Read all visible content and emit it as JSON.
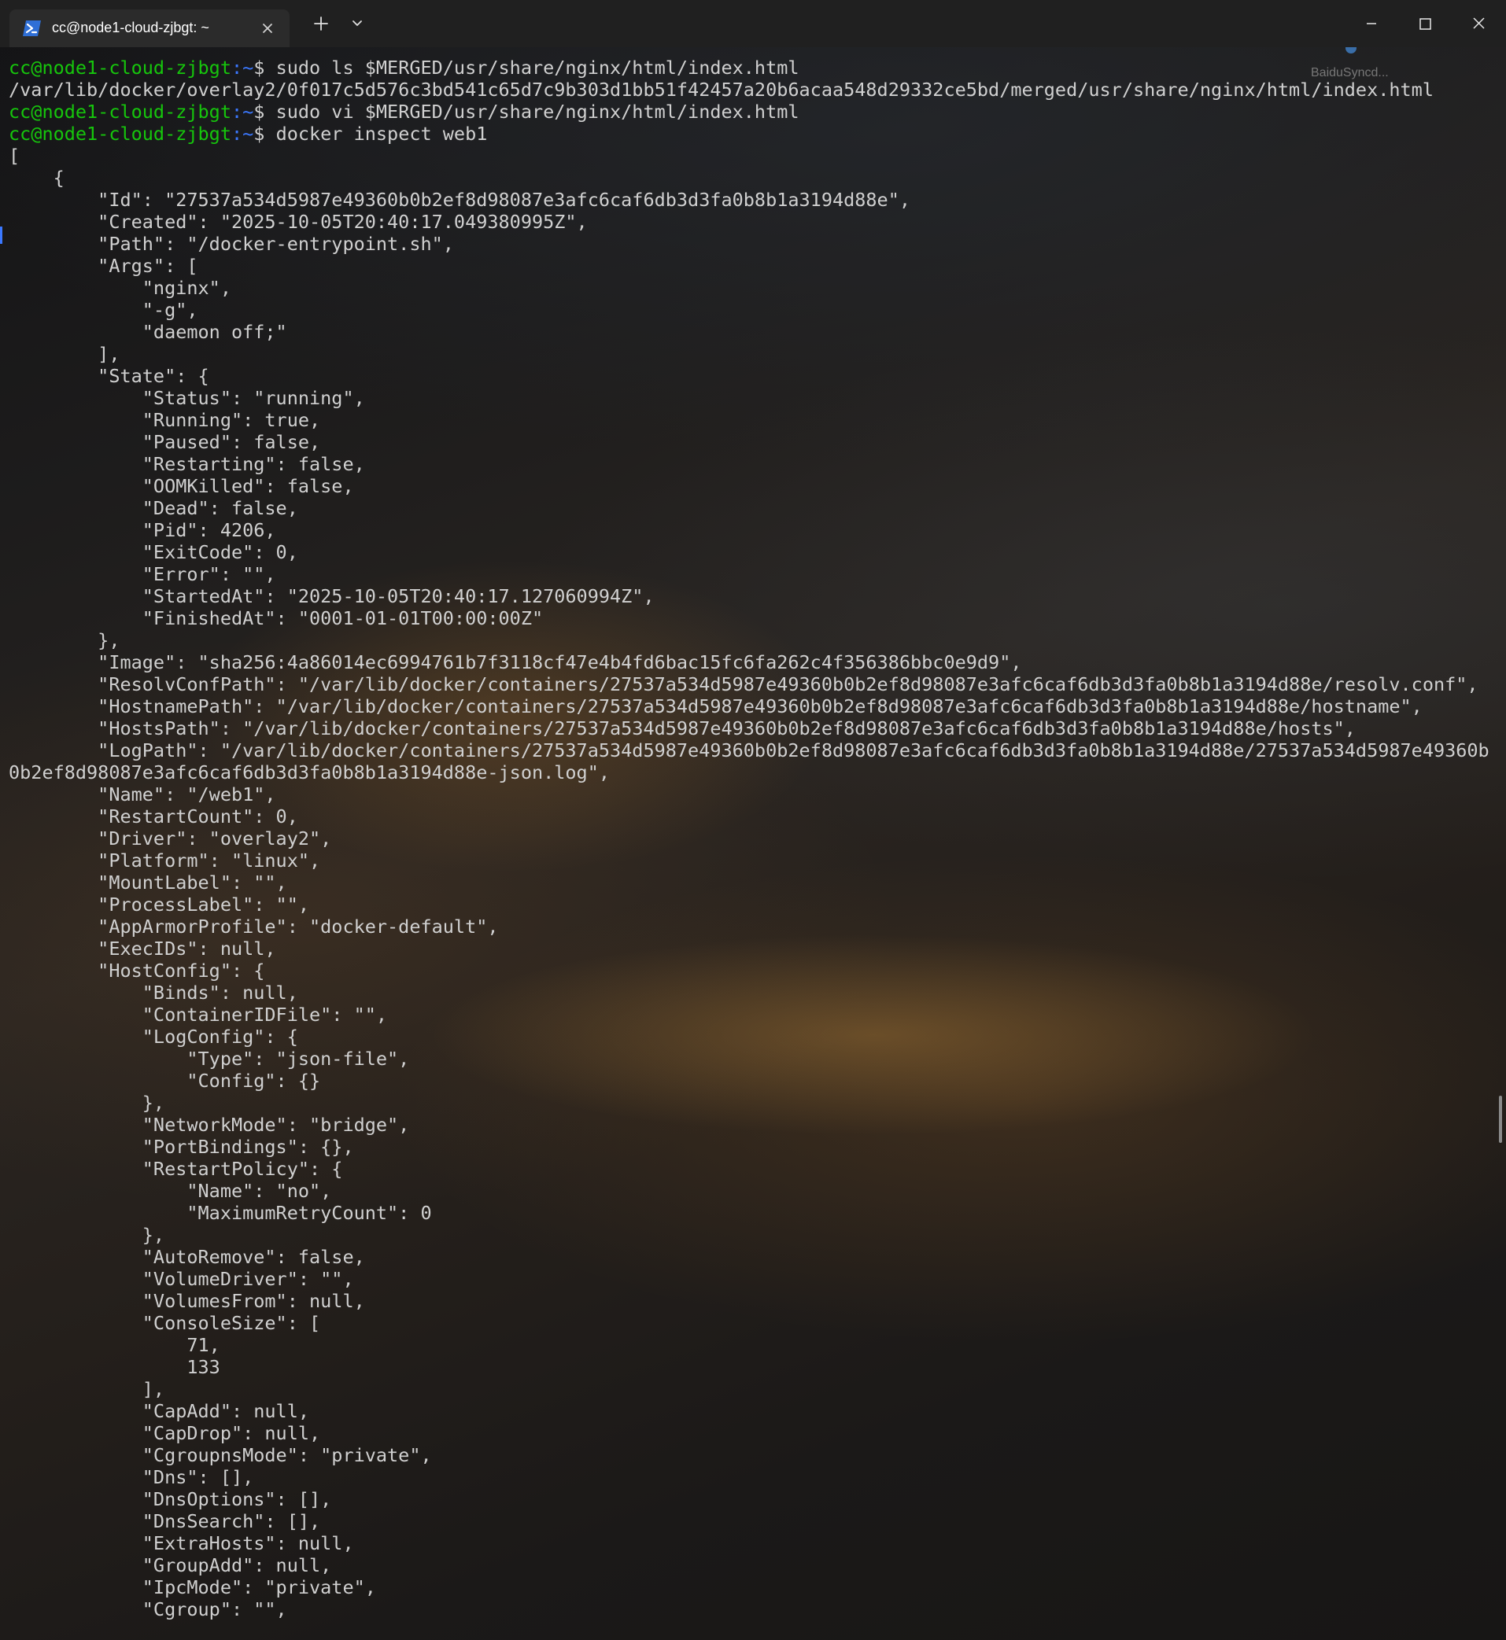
{
  "window": {
    "tab_title": "cc@node1-cloud-zjbgt: ~",
    "tab_icon": "powershell-icon",
    "new_tab_symbol": "+",
    "dropdown_icon": "chevron-down-icon"
  },
  "overlay": {
    "baidu_label": "BaiduSyncd..."
  },
  "prompt": {
    "user_host": "cc@node1-cloud-zjbgt",
    "path": ":~",
    "symbol": "$ "
  },
  "colors": {
    "prompt_user": "#16c60c",
    "prompt_path": "#3b78ff",
    "text": "#d0d0d0"
  },
  "terminal": {
    "lines": [
      {
        "type": "cmd",
        "text": "sudo ls $MERGED/usr/share/nginx/html/index.html"
      },
      {
        "type": "out",
        "text": "/var/lib/docker/overlay2/0f017c5d576c3bd541c65d7c9b303d1bb51f42457a20b6acaa548d29332ce5bd/merged/usr/share/nginx/html/index.html"
      },
      {
        "type": "cmd",
        "text": "sudo vi $MERGED/usr/share/nginx/html/index.html"
      },
      {
        "type": "cmd",
        "text": "docker inspect web1"
      },
      {
        "type": "out",
        "text": "["
      },
      {
        "type": "out",
        "text": "    {"
      },
      {
        "type": "out",
        "text": "        \"Id\": \"27537a534d5987e49360b0b2ef8d98087e3afc6caf6db3d3fa0b8b1a3194d88e\","
      },
      {
        "type": "out",
        "text": "        \"Created\": \"2025-10-05T20:40:17.049380995Z\","
      },
      {
        "type": "out",
        "text": "        \"Path\": \"/docker-entrypoint.sh\","
      },
      {
        "type": "out",
        "text": "        \"Args\": ["
      },
      {
        "type": "out",
        "text": "            \"nginx\","
      },
      {
        "type": "out",
        "text": "            \"-g\","
      },
      {
        "type": "out",
        "text": "            \"daemon off;\""
      },
      {
        "type": "out",
        "text": "        ],"
      },
      {
        "type": "out",
        "text": "        \"State\": {"
      },
      {
        "type": "out",
        "text": "            \"Status\": \"running\","
      },
      {
        "type": "out",
        "text": "            \"Running\": true,"
      },
      {
        "type": "out",
        "text": "            \"Paused\": false,"
      },
      {
        "type": "out",
        "text": "            \"Restarting\": false,"
      },
      {
        "type": "out",
        "text": "            \"OOMKilled\": false,"
      },
      {
        "type": "out",
        "text": "            \"Dead\": false,"
      },
      {
        "type": "out",
        "text": "            \"Pid\": 4206,"
      },
      {
        "type": "out",
        "text": "            \"ExitCode\": 0,"
      },
      {
        "type": "out",
        "text": "            \"Error\": \"\","
      },
      {
        "type": "out",
        "text": "            \"StartedAt\": \"2025-10-05T20:40:17.127060994Z\","
      },
      {
        "type": "out",
        "text": "            \"FinishedAt\": \"0001-01-01T00:00:00Z\""
      },
      {
        "type": "out",
        "text": "        },"
      },
      {
        "type": "out",
        "text": "        \"Image\": \"sha256:4a86014ec6994761b7f3118cf47e4b4fd6bac15fc6fa262c4f356386bbc0e9d9\","
      },
      {
        "type": "out",
        "text": "        \"ResolvConfPath\": \"/var/lib/docker/containers/27537a534d5987e49360b0b2ef8d98087e3afc6caf6db3d3fa0b8b1a3194d88e/resolv.conf\","
      },
      {
        "type": "out",
        "text": "        \"HostnamePath\": \"/var/lib/docker/containers/27537a534d5987e49360b0b2ef8d98087e3afc6caf6db3d3fa0b8b1a3194d88e/hostname\","
      },
      {
        "type": "out",
        "text": "        \"HostsPath\": \"/var/lib/docker/containers/27537a534d5987e49360b0b2ef8d98087e3afc6caf6db3d3fa0b8b1a3194d88e/hosts\","
      },
      {
        "type": "out",
        "text": "        \"LogPath\": \"/var/lib/docker/containers/27537a534d5987e49360b0b2ef8d98087e3afc6caf6db3d3fa0b8b1a3194d88e/27537a534d5987e49360b"
      },
      {
        "type": "out",
        "text": "0b2ef8d98087e3afc6caf6db3d3fa0b8b1a3194d88e-json.log\","
      },
      {
        "type": "out",
        "text": "        \"Name\": \"/web1\","
      },
      {
        "type": "out",
        "text": "        \"RestartCount\": 0,"
      },
      {
        "type": "out",
        "text": "        \"Driver\": \"overlay2\","
      },
      {
        "type": "out",
        "text": "        \"Platform\": \"linux\","
      },
      {
        "type": "out",
        "text": "        \"MountLabel\": \"\","
      },
      {
        "type": "out",
        "text": "        \"ProcessLabel\": \"\","
      },
      {
        "type": "out",
        "text": "        \"AppArmorProfile\": \"docker-default\","
      },
      {
        "type": "out",
        "text": "        \"ExecIDs\": null,"
      },
      {
        "type": "out",
        "text": "        \"HostConfig\": {"
      },
      {
        "type": "out",
        "text": "            \"Binds\": null,"
      },
      {
        "type": "out",
        "text": "            \"ContainerIDFile\": \"\","
      },
      {
        "type": "out",
        "text": "            \"LogConfig\": {"
      },
      {
        "type": "out",
        "text": "                \"Type\": \"json-file\","
      },
      {
        "type": "out",
        "text": "                \"Config\": {}"
      },
      {
        "type": "out",
        "text": "            },"
      },
      {
        "type": "out",
        "text": "            \"NetworkMode\": \"bridge\","
      },
      {
        "type": "out",
        "text": "            \"PortBindings\": {},"
      },
      {
        "type": "out",
        "text": "            \"RestartPolicy\": {"
      },
      {
        "type": "out",
        "text": "                \"Name\": \"no\","
      },
      {
        "type": "out",
        "text": "                \"MaximumRetryCount\": 0"
      },
      {
        "type": "out",
        "text": "            },"
      },
      {
        "type": "out",
        "text": "            \"AutoRemove\": false,"
      },
      {
        "type": "out",
        "text": "            \"VolumeDriver\": \"\","
      },
      {
        "type": "out",
        "text": "            \"VolumesFrom\": null,"
      },
      {
        "type": "out",
        "text": "            \"ConsoleSize\": ["
      },
      {
        "type": "out",
        "text": "                71,"
      },
      {
        "type": "out",
        "text": "                133"
      },
      {
        "type": "out",
        "text": "            ],"
      },
      {
        "type": "out",
        "text": "            \"CapAdd\": null,"
      },
      {
        "type": "out",
        "text": "            \"CapDrop\": null,"
      },
      {
        "type": "out",
        "text": "            \"CgroupnsMode\": \"private\","
      },
      {
        "type": "out",
        "text": "            \"Dns\": [],"
      },
      {
        "type": "out",
        "text": "            \"DnsOptions\": [],"
      },
      {
        "type": "out",
        "text": "            \"DnsSearch\": [],"
      },
      {
        "type": "out",
        "text": "            \"ExtraHosts\": null,"
      },
      {
        "type": "out",
        "text": "            \"GroupAdd\": null,"
      },
      {
        "type": "out",
        "text": "            \"IpcMode\": \"private\","
      },
      {
        "type": "out",
        "text": "            \"Cgroup\": \"\","
      }
    ]
  }
}
